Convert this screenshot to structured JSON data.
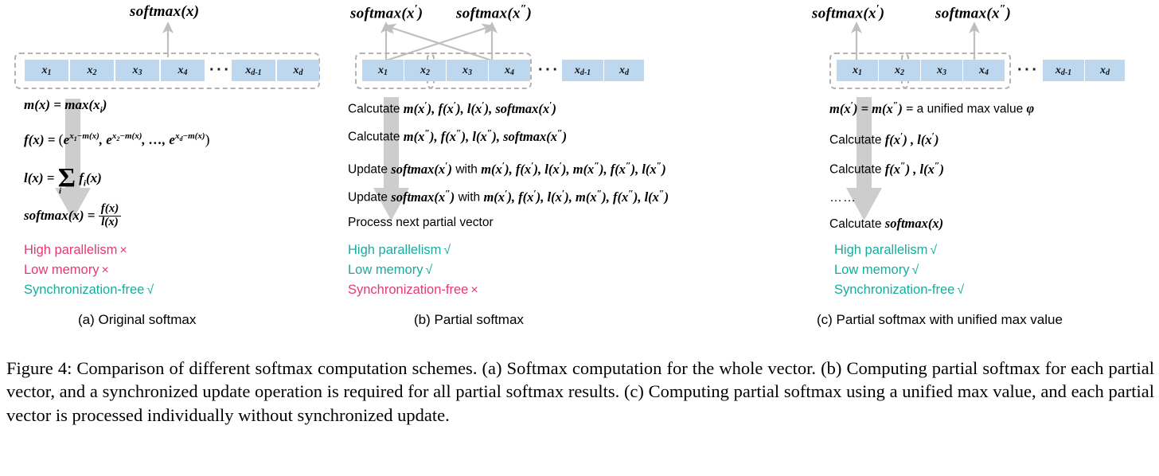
{
  "colors": {
    "cell_fill": "#bdd7ee",
    "dash_border": "#b3b3b3",
    "arrow_gray": "#bfbfbf",
    "negative": "#e5396f",
    "positive": "#17ac9d",
    "text": "#000000"
  },
  "marks": {
    "check": "√",
    "cross": "×"
  },
  "vector": {
    "cells": [
      "x",
      "x",
      "x",
      "x",
      "x",
      "x"
    ],
    "subscripts": [
      "1",
      "2",
      "3",
      "4",
      "d-1",
      "d"
    ],
    "ellipsis": "···"
  },
  "panels": [
    {
      "id": "a",
      "caption": "(a) Original softmax",
      "outputs": [
        {
          "label": "softmax(x)",
          "base": "softmax(x)",
          "prime": ""
        }
      ],
      "formulas": [
        "m(x) = max(xᵢ)",
        "f(x) = (e^{x₁−m(x)}, e^{x₂−m(x)}, …, e^{x_d−m(x)})",
        "l(x) = ∑ᵢ fᵢ(x)",
        "softmax(x) = f(x) / l(x)"
      ],
      "properties": [
        {
          "label": "High parallelism",
          "mark": "×",
          "state": "negative"
        },
        {
          "label": "Low memory",
          "mark": "×",
          "state": "negative"
        },
        {
          "label": "Synchronization-free",
          "mark": "√",
          "state": "positive"
        }
      ]
    },
    {
      "id": "b",
      "caption": "(b) Partial softmax",
      "outputs": [
        {
          "label": "softmax(x′)",
          "base": "softmax(x",
          "prime": "′"
        },
        {
          "label": "softmax(x″)",
          "base": "softmax(x",
          "prime": "″"
        }
      ],
      "steps": [
        "Calcutate m(x′), f(x′), l(x′), softmax(x′)",
        "Calcutate m(x″), f(x″), l(x″), softmax(x″)",
        "Update softmax(x′) with m(x′), f(x′), l(x′), m(x″), f(x″), l(x″)",
        "Update softmax(x″) with m(x′), f(x′), l(x′), m(x″), f(x″), l(x″)",
        "Process next partial vector"
      ],
      "properties": [
        {
          "label": "High parallelism",
          "mark": "√",
          "state": "positive"
        },
        {
          "label": "Low memory",
          "mark": "√",
          "state": "positive"
        },
        {
          "label": "Synchronization-free",
          "mark": "×",
          "state": "negative"
        }
      ]
    },
    {
      "id": "c",
      "caption": "(c) Partial softmax with unified max value",
      "outputs": [
        {
          "label": "softmax(x′)",
          "base": "softmax(x",
          "prime": "′"
        },
        {
          "label": "softmax(x″)",
          "base": "softmax(x",
          "prime": "″"
        }
      ],
      "steps": [
        "m(x′) = m(x″) = a unified max value ϕ",
        "Calcutate f(x′) , l(x′)",
        "Calcutate f(x″) , l(x″)",
        "……",
        "Calcutate softmax(x)"
      ],
      "properties": [
        {
          "label": "High parallelism",
          "mark": "√",
          "state": "positive"
        },
        {
          "label": "Low memory",
          "mark": "√",
          "state": "positive"
        },
        {
          "label": "Synchronization-free",
          "mark": "√",
          "state": "positive"
        }
      ]
    }
  ],
  "figure_caption": "Figure 4: Comparison of different softmax computation schemes. (a) Softmax computation for the whole vector. (b) Computing partial softmax for each partial vector, and a synchronized update operation is required for all partial softmax results. (c) Computing partial softmax using a unified max value, and each partial vector is processed individually without synchronized update."
}
